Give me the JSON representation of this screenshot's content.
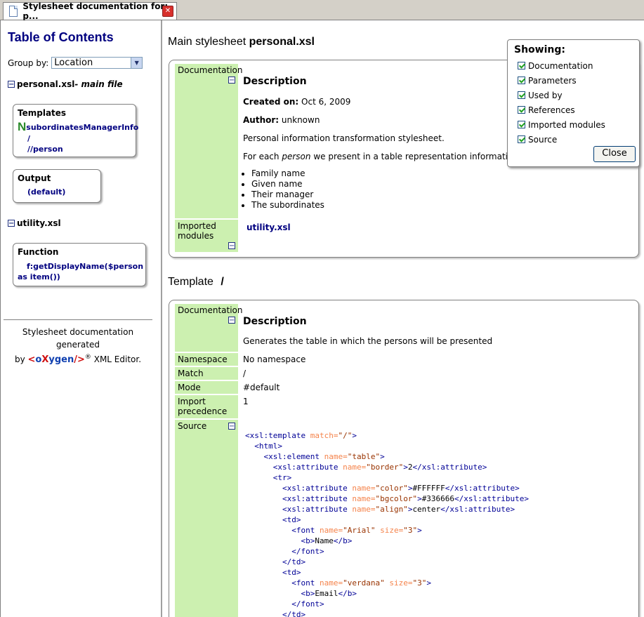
{
  "tab": {
    "title": "Stylesheet documentation for: p..."
  },
  "toc": {
    "title": "Table of Contents",
    "groupby_label": "Group by:",
    "groupby_value": "Location",
    "file1": {
      "name": "personal.xsl",
      "suffix": " - main file"
    },
    "templates_header": "Templates",
    "templates": [
      "subordinatesManagerInfo",
      "/",
      "//person"
    ],
    "output_header": "Output",
    "output_item": "(default)",
    "file2": {
      "name": "utility.xsl"
    },
    "function_header": "Function",
    "function_item": "f:getDisplayName($person as item())",
    "gen_line1": "Stylesheet documentation generated",
    "gen_by": "by",
    "gen_suffix": "XML Editor.",
    "logo_text": "<oXygen/>",
    "registered": "®",
    "big_n": "N"
  },
  "main": {
    "heading1_pre": "Main stylesheet",
    "heading1_name": "personal.xsl",
    "doc_label": "Documentation",
    "desc_title": "Description",
    "created_label": "Created on:",
    "created_value": "Oct 6, 2009",
    "author_label": "Author:",
    "author_value": "unknown",
    "desc_text": "Personal information transformation stylesheet.",
    "foreach_pre": "For each",
    "foreach_em": "person",
    "foreach_post": "we present in a table representation information like:",
    "bullets": [
      "Family name",
      "Given name",
      "Their manager",
      "The subordinates"
    ],
    "imported_label": "Imported modules",
    "imported_value": "utility.xsl",
    "heading2_pre": "Template",
    "heading2_name": "/",
    "t_desc_title": "Description",
    "t_desc_text": "Generates the table in which the persons will be presented",
    "namespace_label": "Namespace",
    "namespace_value": "No namespace",
    "match_label": "Match",
    "match_value": "/",
    "mode_label": "Mode",
    "mode_value": "#default",
    "precedence_label": "Import precedence",
    "precedence_value": "1",
    "source_label": "Source"
  },
  "showing": {
    "title": "Showing:",
    "items": [
      "Documentation",
      "Parameters",
      "Used by",
      "References",
      "Imported modules",
      "Source"
    ],
    "close": "Close"
  }
}
